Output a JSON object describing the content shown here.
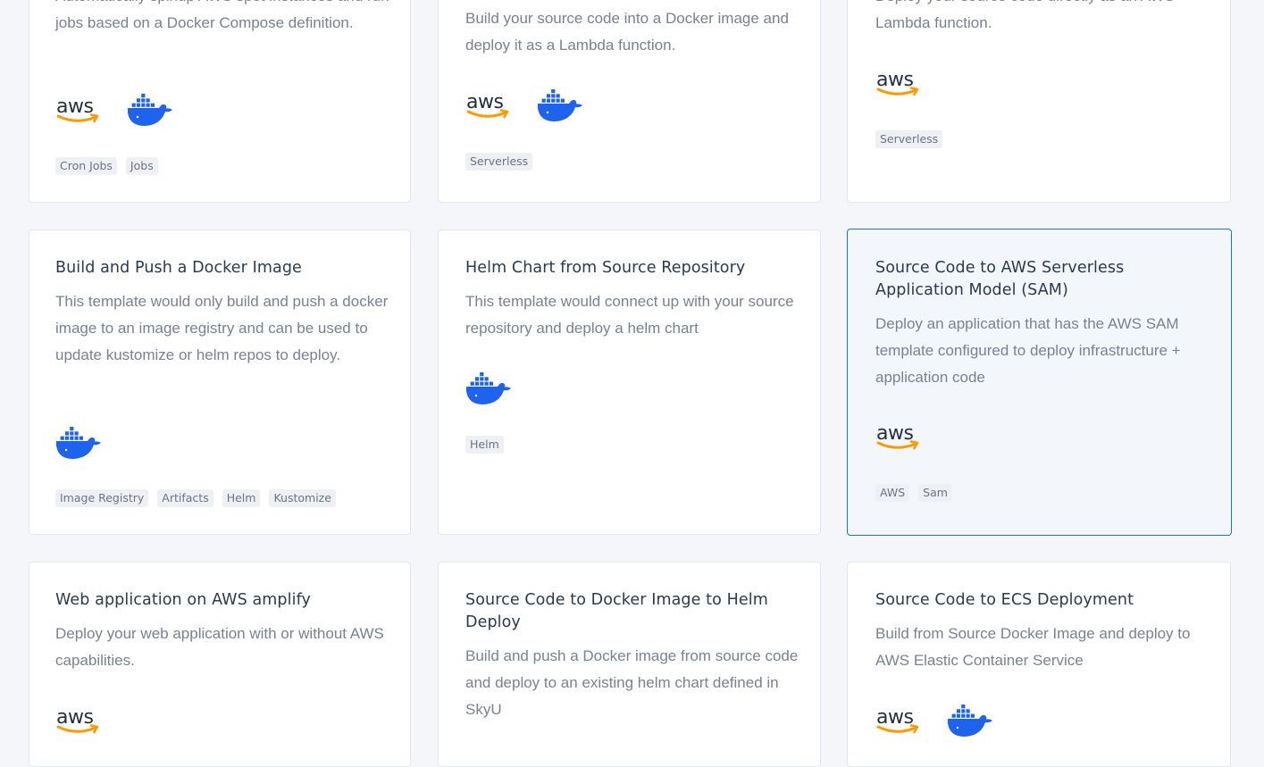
{
  "colors": {
    "accent": "#1976c9",
    "aws_text": "#252f3e",
    "aws_smile": "#ff9900",
    "docker_blue": "#1d63ed"
  },
  "cards": [
    {
      "title": "",
      "desc": "Automatically spinup AWS spot instances and run jobs based on a Docker Compose definition.",
      "logos": [
        "aws-icon",
        "docker-icon"
      ],
      "tags": [
        "Cron Jobs",
        "Jobs"
      ]
    },
    {
      "title": "",
      "desc": "Build your source code into a Docker image and deploy it as a Lambda function.",
      "logos": [
        "aws-icon",
        "docker-icon"
      ],
      "tags": [
        "Serverless"
      ]
    },
    {
      "title": "",
      "desc": "Deploy your source code directly as an AWS Lambda function.",
      "logos": [
        "aws-icon"
      ],
      "tags": [
        "Serverless"
      ]
    },
    {
      "title": "Build and Push a Docker Image",
      "desc": "This template would only build and push a docker image to an image registry and can be used to update kustomize or helm repos to deploy.",
      "logos": [
        "docker-icon"
      ],
      "tags": [
        "Image Registry",
        "Artifacts",
        "Helm",
        "Kustomize"
      ]
    },
    {
      "title": "Helm Chart from Source Repository",
      "desc": "This template would connect up with your source repository and deploy a helm chart",
      "logos": [
        "docker-icon"
      ],
      "tags": [
        "Helm"
      ]
    },
    {
      "title": "Source Code to AWS Serverless Application Model (SAM)",
      "desc": "Deploy an application that has the AWS SAM template configured to deploy infrastructure + application code",
      "logos": [
        "aws-icon"
      ],
      "tags": [
        "AWS",
        "Sam"
      ]
    },
    {
      "title": "Web application on AWS amplify",
      "desc": "Deploy your web application with or without AWS capabilities.",
      "logos": [
        "aws-icon"
      ],
      "tags": []
    },
    {
      "title": "Source Code to Docker Image to Helm Deploy",
      "desc": "Build and push a Docker image from source code and deploy to an existing helm chart defined in SkyU",
      "logos": [],
      "tags": []
    },
    {
      "title": "Source Code to ECS Deployment",
      "desc": "Build from Source Docker Image and deploy to AWS Elastic Container Service",
      "logos": [
        "aws-icon",
        "docker-icon"
      ],
      "tags": []
    }
  ]
}
